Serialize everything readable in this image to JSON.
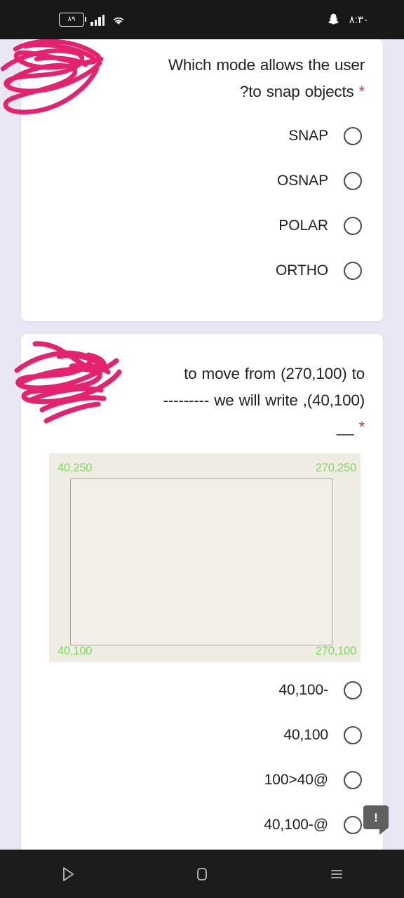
{
  "status_bar": {
    "battery_level": "٨٩",
    "battery_icon": "battery-icon",
    "signal_icon": "cellular-signal-icon",
    "wifi_icon": "wifi-icon",
    "app_icon": "snapchat-icon",
    "time": "٨:٣٠"
  },
  "form": {
    "questions": [
      {
        "id": "q1",
        "text": "Which mode allows the user to snap objects?",
        "text_line1": "Which mode allows the user",
        "text_line2": "to snap objects?",
        "required_marker": "*",
        "options": [
          {
            "label": "SNAP",
            "selected": false
          },
          {
            "label": "OSNAP",
            "selected": false
          },
          {
            "label": "POLAR",
            "selected": false
          },
          {
            "label": "ORTHO",
            "selected": false
          }
        ]
      },
      {
        "id": "q2",
        "text": "to move from (270,100) to (40,100), we will write --------- __",
        "text_line1": "to move from (270,100) to",
        "text_line2": "(40,100), we will write ---------",
        "text_line3": "__",
        "required_marker": "*",
        "diagram": {
          "name": "coordinate-rectangle-diagram",
          "corner_top_left": "40,250",
          "corner_top_right": "270,250",
          "corner_bottom_left": "40,100",
          "corner_bottom_right": "270,100",
          "label_color": "#7ed957",
          "background_color": "#efece4"
        },
        "options": [
          {
            "label": "-40,100",
            "selected": false
          },
          {
            "label": "40,100",
            "selected": false
          },
          {
            "label": "@40<100",
            "selected": false
          },
          {
            "label": "@-40,100",
            "selected": false
          }
        ]
      }
    ]
  },
  "annotations": {
    "scribble_color": "#e4226f",
    "scribbles": [
      {
        "name": "scribble-over-question-1"
      },
      {
        "name": "scribble-over-question-2"
      }
    ],
    "tooltip": {
      "glyph": "!",
      "color": "#5f5f5f"
    }
  },
  "nav_bar": {
    "back_icon": "back-triangle-icon",
    "home_icon": "home-square-icon",
    "recents_icon": "recents-menu-icon"
  },
  "theme": {
    "background": "#eae7f4",
    "card": "#ffffff",
    "required_star": "#c0392b",
    "text": "#232323"
  }
}
